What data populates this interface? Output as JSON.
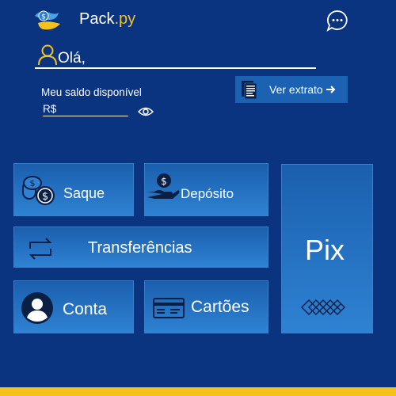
{
  "header": {
    "brand_main": "Pack",
    "brand_accent": ".py",
    "logo_icon": "bird-money-logo",
    "chat_icon": "chat-bubble-icon"
  },
  "greeting": {
    "text": "Olá,",
    "icon": "user-outline-icon"
  },
  "balance": {
    "label": "Meu saldo disponível",
    "currency": "R$",
    "visibility_icon": "eye-icon"
  },
  "statement_button": {
    "label": "Ver extrato",
    "icon": "document-icon",
    "arrow": "arrow-right-icon"
  },
  "actions": {
    "saque": {
      "label": "Saque",
      "icon": "coins-icon"
    },
    "deposito": {
      "label": "Depósito",
      "icon": "hand-money-icon"
    },
    "transferencias": {
      "label": "Transferências",
      "icon": "swap-arrows-icon"
    },
    "conta": {
      "label": "Conta",
      "icon": "account-circle-icon"
    },
    "cartoes": {
      "label": "Cartões",
      "icon": "credit-card-icon"
    },
    "pix": {
      "label": "Pix",
      "icon": "pix-diamonds-icon"
    }
  },
  "colors": {
    "background": "#0a3380",
    "tile_top": "#1a5fae",
    "tile_bottom": "#2f82d3",
    "accent_yellow": "#f4c21b",
    "button_blue": "#1c62b3"
  }
}
